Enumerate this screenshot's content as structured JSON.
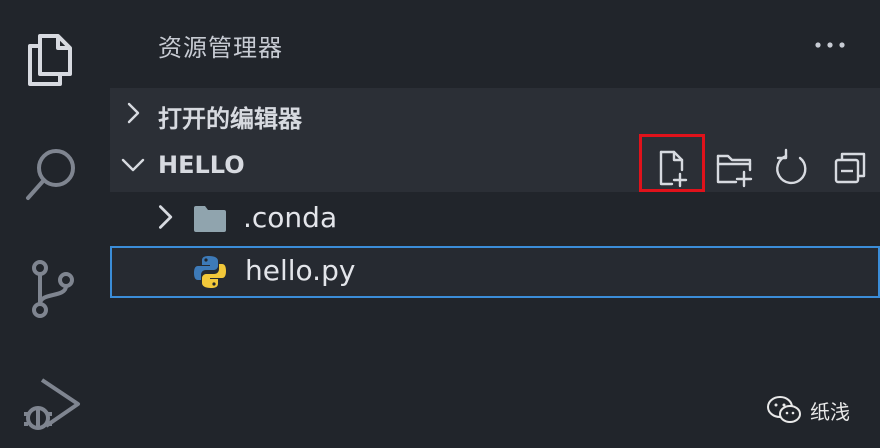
{
  "activity_bar": {
    "items": [
      {
        "icon": "files-icon"
      },
      {
        "icon": "search-icon"
      },
      {
        "icon": "source-control-icon"
      },
      {
        "icon": "run-debug-icon"
      }
    ]
  },
  "explorer": {
    "title": "资源管理器",
    "more_icon": "ellipsis-icon",
    "sections": {
      "open_editors": {
        "label": "打开的编辑器",
        "expanded": false
      },
      "workspace": {
        "label": "HELLO",
        "expanded": true,
        "actions": [
          "new-file-icon",
          "new-folder-icon",
          "refresh-icon",
          "collapse-all-icon"
        ],
        "highlighted_action": "new-file-icon"
      }
    },
    "tree": [
      {
        "name": ".conda",
        "type": "folder",
        "expanded": false
      },
      {
        "name": "hello.py",
        "type": "python-file",
        "selected": true
      }
    ]
  },
  "watermark": {
    "text": "纸浅",
    "icon": "wechat-icon"
  },
  "colors": {
    "background": "#21252b",
    "section_bg": "#2b2f36",
    "selection_border": "#3b8dd8",
    "highlight": "#e0121b"
  }
}
